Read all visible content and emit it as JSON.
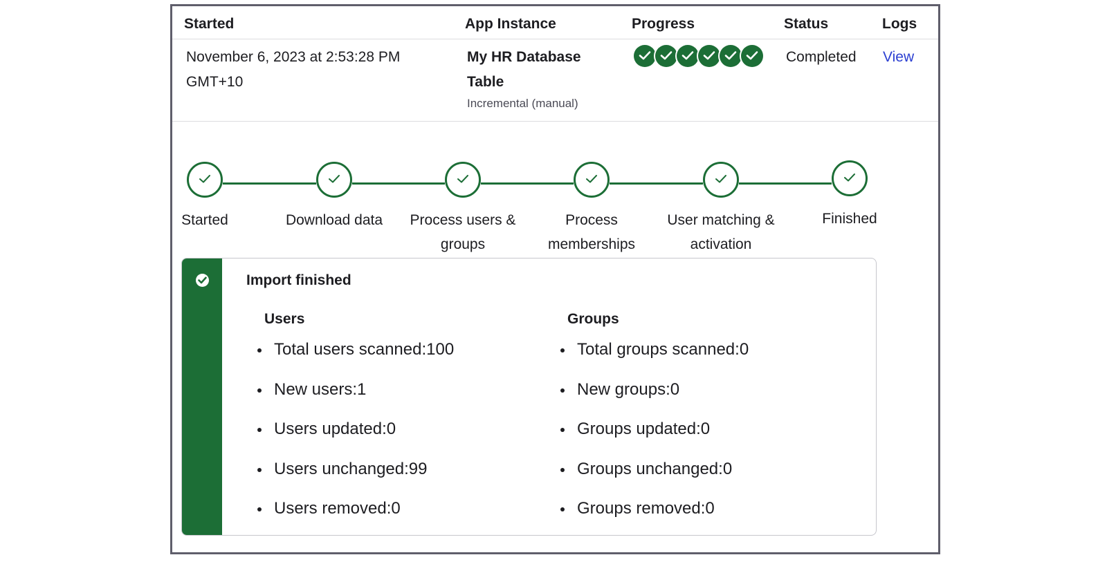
{
  "table": {
    "headers": {
      "started": "Started",
      "app_instance": "App Instance",
      "progress": "Progress",
      "status": "Status",
      "logs": "Logs"
    },
    "row": {
      "started": "November 6, 2023 at 2:53:28 PM GMT+10",
      "app_name": "My HR Database Table",
      "app_subtext": "Incremental (manual)",
      "progress_steps_completed": 6,
      "progress_steps_total": 6,
      "status": "Completed",
      "logs_link": "View"
    }
  },
  "stepper": {
    "steps": [
      {
        "label": "Started",
        "state": "complete"
      },
      {
        "label": "Download data",
        "state": "complete"
      },
      {
        "label": "Process users & groups",
        "state": "complete"
      },
      {
        "label": "Process memberships",
        "state": "complete"
      },
      {
        "label": "User matching & activation",
        "state": "complete"
      },
      {
        "label": "Finished",
        "state": "complete"
      }
    ]
  },
  "result": {
    "title": "Import finished",
    "users": {
      "heading": "Users",
      "items": [
        "Total users scanned:100",
        "New users:1",
        "Users updated:0",
        "Users unchanged:99",
        "Users removed:0"
      ]
    },
    "groups": {
      "heading": "Groups",
      "items": [
        "Total groups scanned:0",
        "New groups:0",
        "Groups updated:0",
        "Groups unchanged:0",
        "Groups removed:0"
      ]
    }
  },
  "colors": {
    "success": "#1c6e36",
    "link": "#2b3fd1",
    "border": "#5f5e6b"
  },
  "icons": {
    "progress_dot": "check-circle-icon",
    "step": "check-icon",
    "result": "check-circle-icon"
  }
}
